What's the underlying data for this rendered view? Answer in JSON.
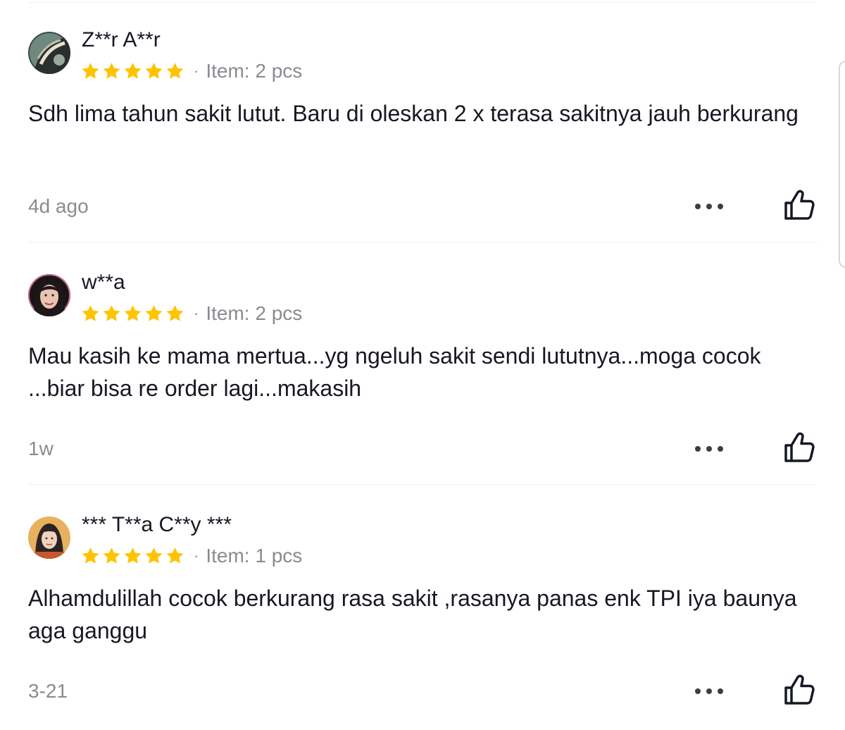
{
  "reviews": [
    {
      "username": "Z**r A**r",
      "rating": 5,
      "separator": "·",
      "item": "Item: 2 pcs",
      "text": "Sdh lima tahun sakit lutut. Baru di oleskan 2 x terasa sakitnya jauh berkurang",
      "date": "4d ago"
    },
    {
      "username": "w**a",
      "rating": 5,
      "separator": "·",
      "item": "Item: 2 pcs",
      "text": "Mau kasih ke mama mertua...yg ngeluh sakit sendi lututnya...moga cocok ...biar bisa re order lagi...makasih",
      "date": "1w"
    },
    {
      "username": "*** T**a C**y ***",
      "rating": 5,
      "separator": "·",
      "item": "Item: 1 pcs",
      "text": "Alhamdulillah cocok berkurang rasa sakit ,rasanya panas enk TPI iya baunya aga ganggu",
      "date": "3-21"
    }
  ],
  "icons": {
    "star": "star-icon",
    "more": "more-options-icon",
    "like": "thumbs-up-icon"
  },
  "colors": {
    "star": "#FFC300",
    "text_primary": "#161823",
    "text_secondary": "#8A8B91",
    "divider": "#EFEFEF"
  }
}
